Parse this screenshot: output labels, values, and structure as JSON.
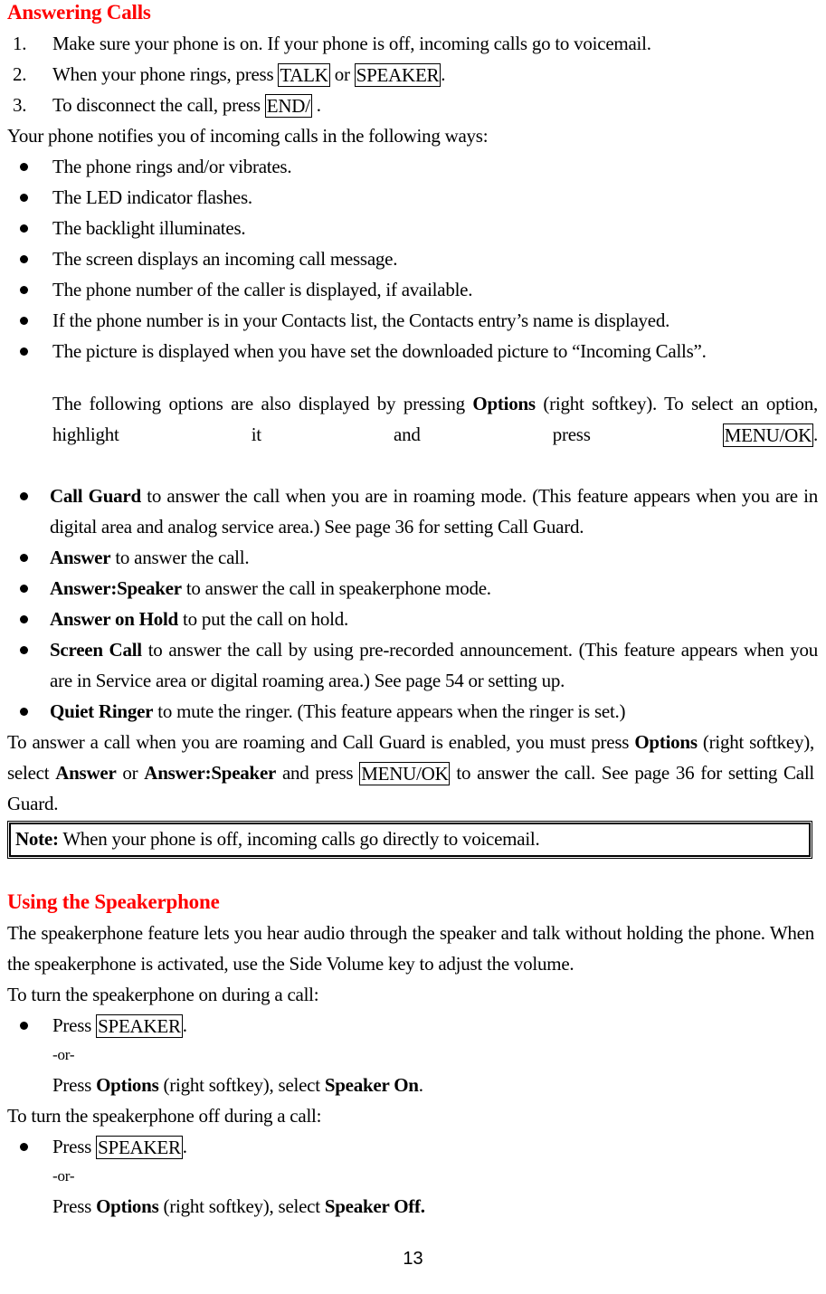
{
  "document": {
    "page_number": "13",
    "heading_color": "#ff0000",
    "text_color": "#000000",
    "background_color": "#ffffff"
  },
  "sections": [
    {
      "id": "answering-calls",
      "heading": "Answering Calls",
      "numbered_steps": [
        {
          "num": "1.",
          "pre": "Make sure your phone is on. If your phone is off, incoming calls go to voicemail.",
          "keys": []
        },
        {
          "num": "2.",
          "pre": "When your phone rings, press ",
          "key1": "TALK",
          "mid": " or ",
          "key2": "SPEAKER",
          "post": "."
        },
        {
          "num": "3.",
          "pre": "To disconnect the call, press ",
          "key1": "END/",
          "post": " ."
        }
      ],
      "notify_lead": "Your phone notifies you of incoming calls in the following ways:",
      "notify_bullets": [
        "The phone rings and/or vibrates.",
        "The LED indicator flashes.",
        "The backlight illuminates.",
        "The screen displays an incoming call message.",
        "The phone number of the caller is displayed, if available.",
        "If the phone number is in your Contacts list, the Contacts entry’s name is displayed.",
        "The picture is displayed when you have set the downloaded picture to “Incoming Calls”."
      ],
      "options_intro": {
        "part1": "The following options are also displayed by pressing ",
        "bold1": "Options",
        "part2": " (right softkey). To select an option, highlight it and press ",
        "key1": "MENU/OK",
        "part3": "."
      },
      "option_bullets": [
        {
          "bold": "Call Guard",
          "text": " to answer the call when you are in roaming mode. (This feature appears when you are in digital area and analog service area.) See page 36 for setting Call Guard."
        },
        {
          "bold": "Answer",
          "text": " to answer the call."
        },
        {
          "bold": "Answer:Speaker",
          "text": " to answer the call in speakerphone mode."
        },
        {
          "bold": "Answer on Hold",
          "text": " to put the call on hold."
        },
        {
          "bold": "Screen Call",
          "text": " to answer the call by using pre-recorded announcement. (This feature appears when you are in Service area or digital roaming area.) See page 54 or setting up."
        },
        {
          "bold": "Quiet Ringer",
          "text": " to mute the ringer. (This feature appears when the ringer is set.)"
        }
      ],
      "roaming_para": {
        "part1": "To answer a call when you are roaming and Call Guard is enabled, you must press ",
        "bold1": "Options",
        "part2": " (right softkey), select ",
        "bold2": "Answer",
        "part3": " or ",
        "bold3": "Answer:Speaker",
        "part4": " and press ",
        "key1": "MENU/OK",
        "part5": " to answer the call. See page 36 for setting Call Guard."
      },
      "note": {
        "label": "Note:",
        "text": " When your phone is off, incoming calls go directly to voicemail."
      }
    },
    {
      "id": "using-the-speakerphone",
      "heading": "Using the Speakerphone",
      "intro": "The speakerphone feature lets you hear audio through the speaker and talk without holding the phone. When the speakerphone is activated, use the Side Volume key to adjust the volume.",
      "turn_on_lead": "To turn the speakerphone on during a call:",
      "turn_on_bullet": {
        "pre": "Press ",
        "key": "SPEAKER",
        "post": "."
      },
      "turn_on_or": "-or-",
      "turn_on_alt": {
        "part1": "Press ",
        "bold1": "Options",
        "part2": " (right softkey), select ",
        "bold2": "Speaker On",
        "part3": "."
      },
      "turn_off_lead": "To turn the speakerphone off during a call:",
      "turn_off_bullet": {
        "pre": "Press ",
        "key": "SPEAKER",
        "post": "."
      },
      "turn_off_or": "-or-",
      "turn_off_alt": {
        "part1": "Press ",
        "bold1": "Options",
        "part2": " (right softkey), select ",
        "bold2": "Speaker Off."
      }
    }
  ]
}
